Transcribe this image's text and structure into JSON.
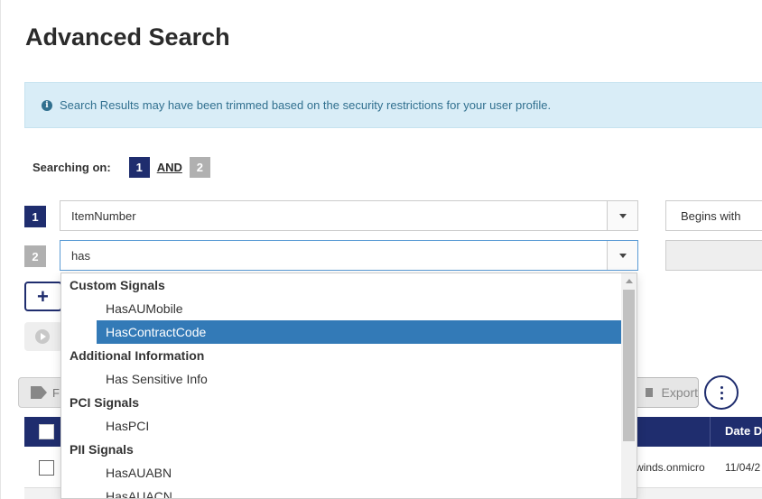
{
  "page": {
    "title": "Advanced Search"
  },
  "info_banner": {
    "icon": "info-icon",
    "text": "Search Results may have been trimmed based on the security restrictions for your user profile."
  },
  "searching_on": {
    "label": "Searching on:",
    "badge1": "1",
    "operator": "AND",
    "badge2": "2"
  },
  "criteria": [
    {
      "index": "1",
      "field_value": "ItemNumber",
      "operator": "Begins with"
    },
    {
      "index": "2",
      "field_value": "has",
      "operator": ""
    }
  ],
  "toolbar": {
    "tag_label": "F",
    "export_label": "Export"
  },
  "table": {
    "header_date": "Date D",
    "row1": {
      "email_fragment": "winds.onmicro",
      "date_fragment": "11/04/2"
    }
  },
  "dropdown": {
    "groups": [
      {
        "label": "Custom Signals",
        "options": [
          "HasAUMobile",
          "HasContractCode"
        ]
      },
      {
        "label": "Additional Information",
        "options": [
          "Has Sensitive Info"
        ]
      },
      {
        "label": "PCI Signals",
        "options": [
          "HasPCI"
        ]
      },
      {
        "label": "PII Signals",
        "options": [
          "HasAUABN",
          "HasAUACN"
        ]
      }
    ],
    "selected": "HasContractCode"
  },
  "colors": {
    "navy": "#1f2d6e",
    "info_bg": "#d9edf7",
    "info_text": "#31708f",
    "selected": "#337ab7"
  }
}
